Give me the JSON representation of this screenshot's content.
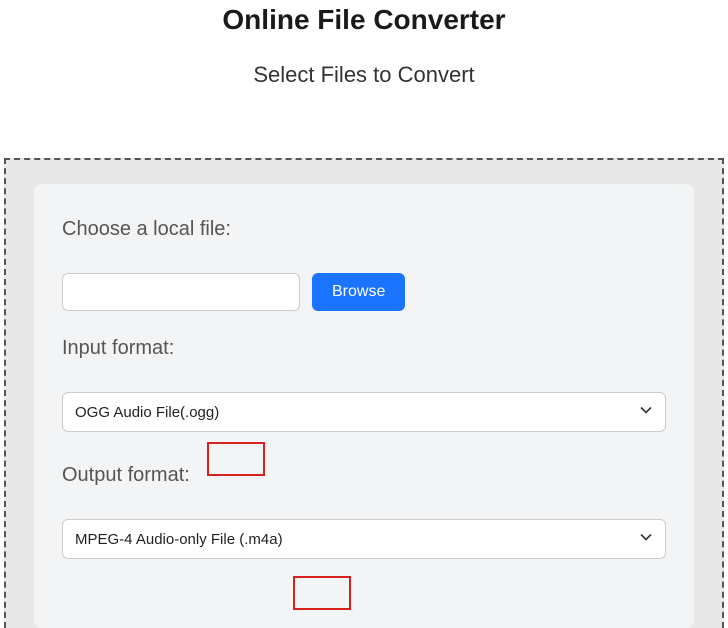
{
  "header": {
    "title": "Online File Converter",
    "subtitle": "Select Files to Convert"
  },
  "form": {
    "choose_label": "Choose a local file:",
    "file_value": "",
    "browse_label": "Browse",
    "input_format_label": "Input format:",
    "input_format_value": "OGG Audio File(.ogg)",
    "output_format_label": "Output format:",
    "output_format_value": "MPEG-4 Audio-only File (.m4a)"
  },
  "highlights": {
    "box1_target": "(.ogg)",
    "box2_target": "(.m4a)"
  },
  "colors": {
    "browse_bg": "#1a74ff",
    "highlight_border": "#d62020"
  }
}
